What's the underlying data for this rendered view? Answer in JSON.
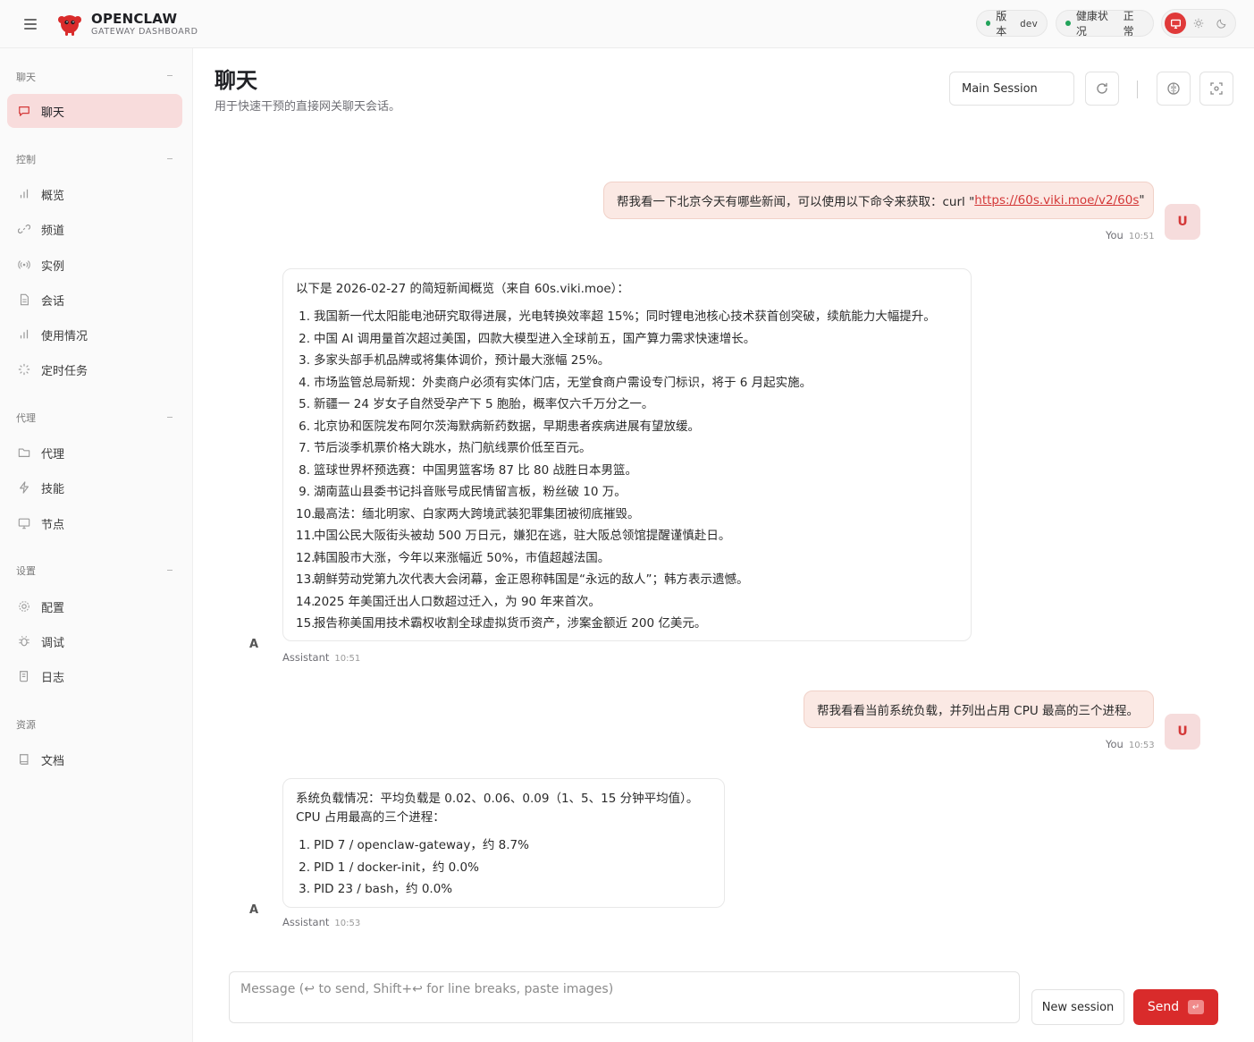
{
  "brand": {
    "title": "OPENCLAW",
    "subtitle": "GATEWAY DASHBOARD"
  },
  "status": {
    "version_label": "版本",
    "version_value": "dev",
    "health_label": "健康状况",
    "health_value": "正常",
    "dot_color": "#22a35a"
  },
  "theme": {
    "options": [
      "monitor-icon",
      "sun-icon",
      "moon-icon"
    ],
    "active": "monitor-icon",
    "accent": "#d92b2b"
  },
  "sidebar": {
    "sections": [
      {
        "label": "聊天",
        "items": [
          {
            "label": "聊天",
            "icon": "message-icon",
            "active": true
          }
        ]
      },
      {
        "label": "控制",
        "items": [
          {
            "label": "概览",
            "icon": "bar-chart-icon"
          },
          {
            "label": "频道",
            "icon": "link-icon"
          },
          {
            "label": "实例",
            "icon": "radio-icon"
          },
          {
            "label": "会话",
            "icon": "file-text-icon"
          },
          {
            "label": "使用情况",
            "icon": "bar-chart-icon"
          },
          {
            "label": "定时任务",
            "icon": "loader-icon"
          }
        ]
      },
      {
        "label": "代理",
        "items": [
          {
            "label": "代理",
            "icon": "folder-icon"
          },
          {
            "label": "技能",
            "icon": "zap-icon"
          },
          {
            "label": "节点",
            "icon": "monitor-icon"
          }
        ]
      },
      {
        "label": "设置",
        "items": [
          {
            "label": "配置",
            "icon": "settings-icon"
          },
          {
            "label": "调试",
            "icon": "bug-icon"
          },
          {
            "label": "日志",
            "icon": "scroll-icon"
          }
        ]
      },
      {
        "label": "资源",
        "items": [
          {
            "label": "文档",
            "icon": "book-icon"
          }
        ]
      }
    ]
  },
  "header": {
    "title": "聊天",
    "subtitle": "用于快速干预的直接网关聊天会话。",
    "session": "Main Session"
  },
  "messages": [
    {
      "role": "user",
      "text_prefix": "帮我看一下北京今天有哪些新闻，可以使用以下命令来获取：curl \"",
      "link": "https://60s.viki.moe/v2/60s",
      "text_suffix": "\"",
      "sender": "You",
      "time": "10:51",
      "avatar": "U"
    },
    {
      "role": "assistant",
      "intro": "以下是 2026-02-27 的简短新闻概览（来自 60s.viki.moe）：",
      "items": [
        "我国新一代太阳能电池研究取得进展，光电转换效率超 15%；同时锂电池核心技术获首创突破，续航能力大幅提升。",
        "中国 AI 调用量首次超过美国，四款大模型进入全球前五，国产算力需求快速增长。",
        "多家头部手机品牌或将集体调价，预计最大涨幅 25%。",
        "市场监管总局新规：外卖商户必须有实体门店，无堂食商户需设专门标识，将于 6 月起实施。",
        "新疆一 24 岁女子自然受孕产下 5 胞胎，概率仅六千万分之一。",
        "北京协和医院发布阿尔茨海默病新药数据，早期患者疾病进展有望放缓。",
        "节后淡季机票价格大跳水，热门航线票价低至百元。",
        "篮球世界杯预选赛：中国男篮客场 87 比 80 战胜日本男篮。",
        "湖南蓝山县委书记抖音账号成民情留言板，粉丝破 10 万。",
        "最高法：缅北明家、白家两大跨境武装犯罪集团被彻底摧毁。",
        "中国公民大阪街头被劫 500 万日元，嫌犯在逃，驻大阪总领馆提醒谨慎赴日。",
        "韩国股市大涨，今年以来涨幅近 50%，市值超越法国。",
        "朝鲜劳动党第九次代表大会闭幕，金正恩称韩国是“永远的敌人”；韩方表示遗憾。",
        "2025 年美国迁出人口数超过迁入，为 90 年来首次。",
        "报告称美国用技术霸权收割全球虚拟货币资产，涉案金额近 200 亿美元。"
      ],
      "sender": "Assistant",
      "time": "10:51",
      "avatar": "A"
    },
    {
      "role": "user",
      "text": "帮我看看当前系统负载，并列出占用 CPU 最高的三个进程。",
      "sender": "You",
      "time": "10:53",
      "avatar": "U"
    },
    {
      "role": "assistant",
      "intro_line1": "系统负载情况：平均负载是 0.02、0.06、0.09（1、5、15 分钟平均值）。",
      "intro_line2": "CPU 占用最高的三个进程：",
      "items": [
        "PID 7 / openclaw-gateway，约 8.7%",
        "PID 1 / docker-init，约 0.0%",
        "PID 23 / bash，约 0.0%"
      ],
      "sender": "Assistant",
      "time": "10:53",
      "avatar": "A"
    }
  ],
  "composer": {
    "placeholder": "Message (↩ to send, Shift+↩ for line breaks, paste images)",
    "new_session": "New session",
    "send": "Send",
    "send_key": "↵"
  }
}
